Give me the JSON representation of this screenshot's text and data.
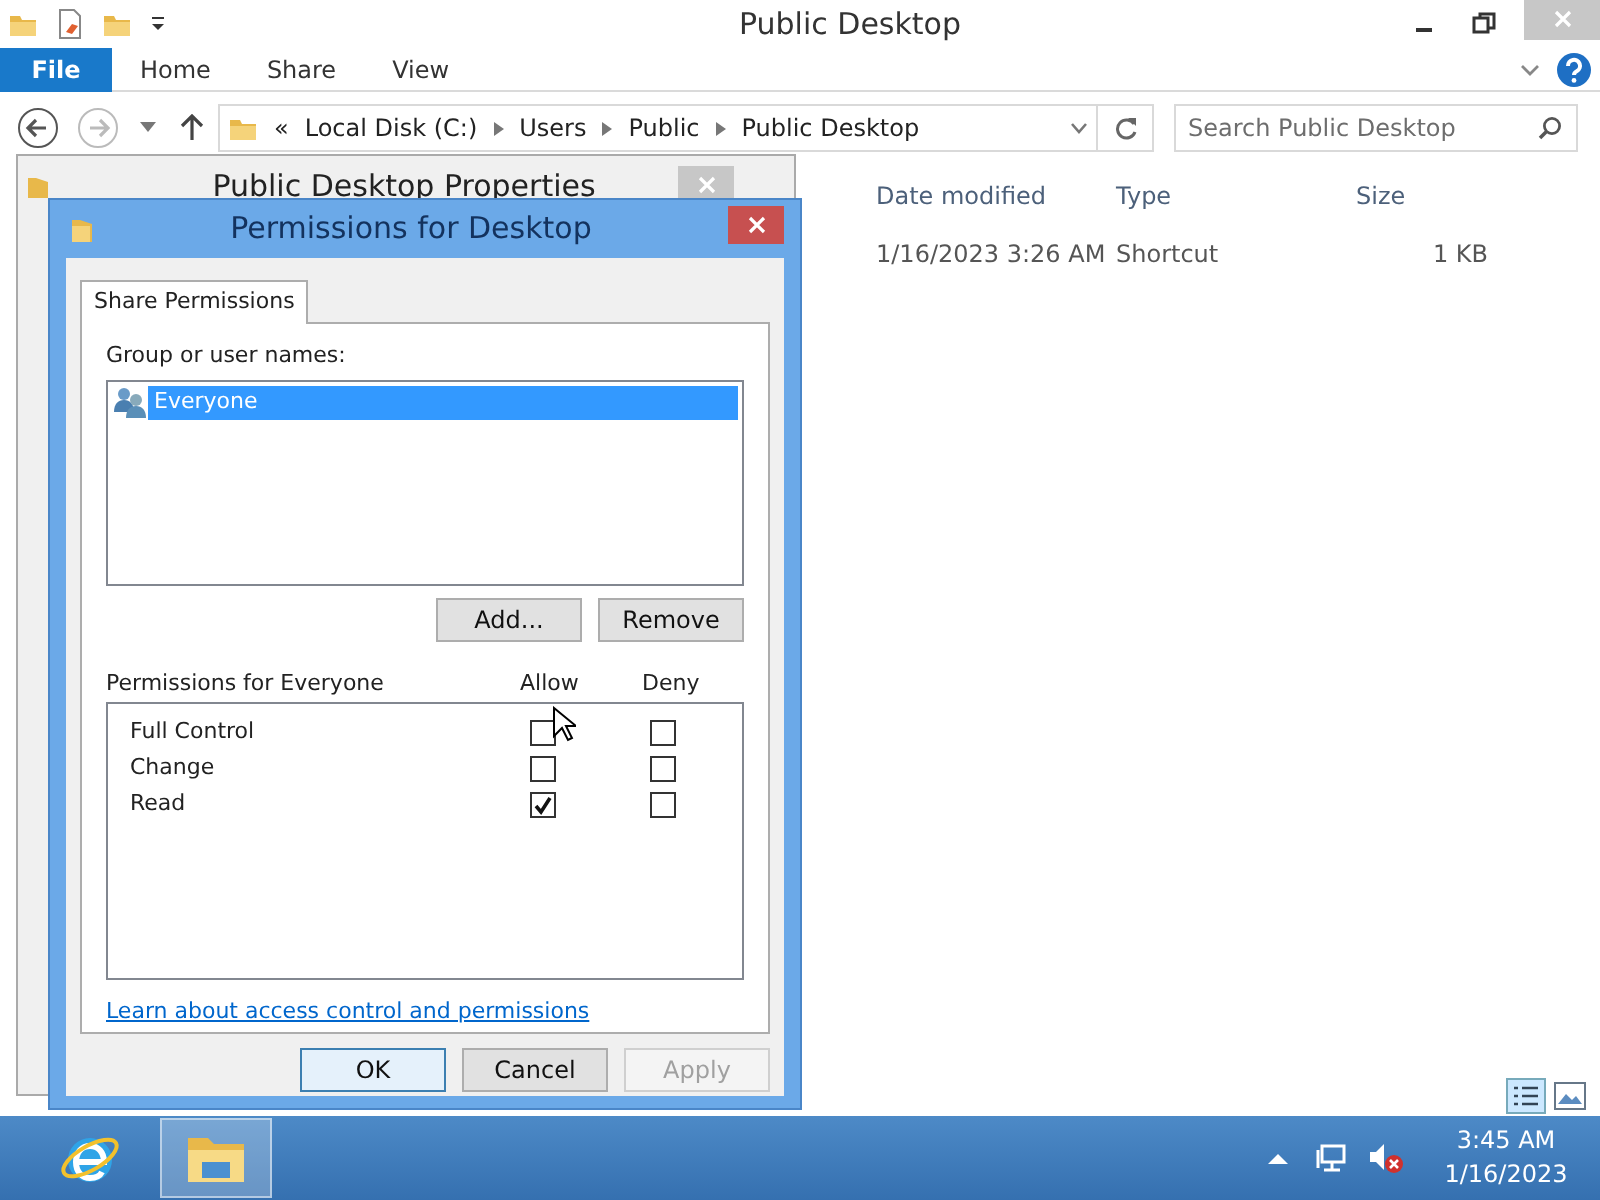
{
  "explorer": {
    "title": "Public Desktop",
    "ribbon_tabs": [
      {
        "label": "File",
        "kind": "file"
      },
      {
        "label": "Home",
        "kind": "tab"
      },
      {
        "label": "Share",
        "kind": "tab"
      },
      {
        "label": "View",
        "kind": "tab"
      }
    ],
    "breadcrumb": [
      "«",
      "Local Disk (C:)",
      "Users",
      "Public",
      "Public Desktop"
    ],
    "search": {
      "placeholder": "Search Public Desktop"
    },
    "columns": [
      "Date modified",
      "Type",
      "Size"
    ],
    "rows": [
      {
        "date": "1/16/2023 3:26 AM",
        "type": "Shortcut",
        "size": "1 KB"
      }
    ]
  },
  "properties_window": {
    "title": "Public Desktop Properties"
  },
  "dialog": {
    "title": "Permissions for Desktop",
    "tab": "Share Permissions",
    "group_label": "Group or user names:",
    "users": [
      {
        "name": "Everyone",
        "selected": true
      }
    ],
    "user_buttons": [
      "Add...",
      "Remove"
    ],
    "permissions_label": "Permissions for Everyone",
    "allow_header": "Allow",
    "deny_header": "Deny",
    "permissions": [
      {
        "name": "Full Control",
        "allow": false,
        "deny": false
      },
      {
        "name": "Change",
        "allow": false,
        "deny": false
      },
      {
        "name": "Read",
        "allow": true,
        "deny": false
      }
    ],
    "link": "Learn about access control and permissions",
    "buttons": [
      {
        "label": "OK",
        "disabled": false
      },
      {
        "label": "Cancel",
        "disabled": false
      },
      {
        "label": "Apply",
        "disabled": true
      }
    ]
  },
  "taskbar": {
    "time": "3:45 AM",
    "date": "1/16/2023"
  }
}
